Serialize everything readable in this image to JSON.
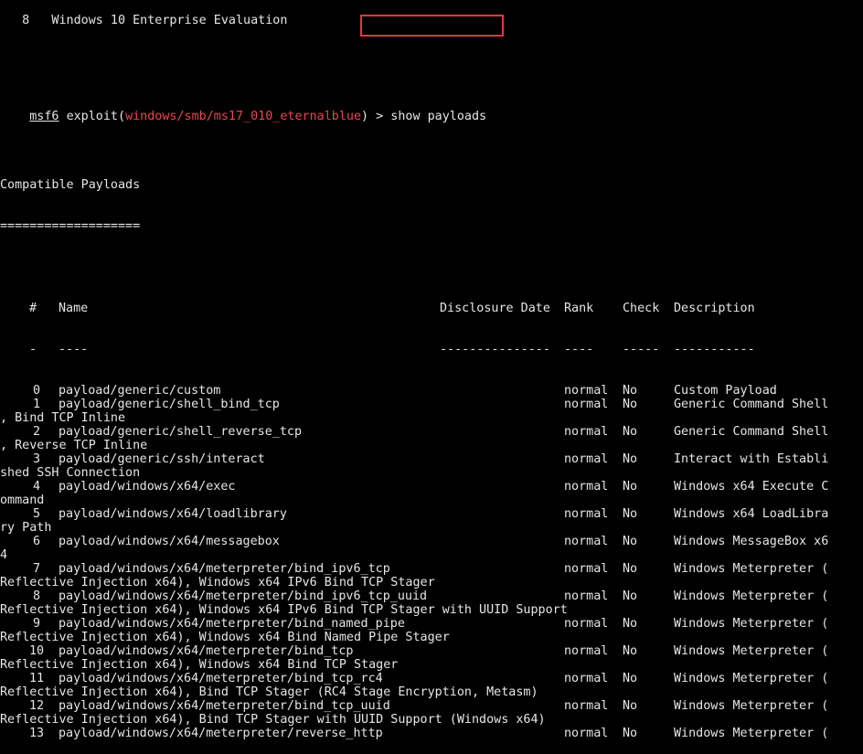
{
  "prior_line": "   8   Windows 10 Enterprise Evaluation",
  "prompt": {
    "app": "msf6",
    "word": "exploit",
    "open_paren": "(",
    "module": "windows/smb/ms17_010_eternalblue",
    "close_paren": ")",
    "symbol": ">",
    "command": "show payloads"
  },
  "section_title": "Compatible Payloads",
  "section_rule": "===================",
  "headers": {
    "num": "#",
    "name": "Name",
    "date": "Disclosure Date",
    "rank": "Rank",
    "check": "Check",
    "desc": "Description"
  },
  "dashes": {
    "num": "-",
    "name": "----",
    "date": "---------------",
    "rank": "----",
    "check": "-----",
    "desc": "-----------"
  },
  "rows": [
    {
      "num": "0",
      "name": "payload/generic/custom",
      "rank": "normal",
      "check": "No",
      "desc": "Custom Payload",
      "cont": ""
    },
    {
      "num": "1",
      "name": "payload/generic/shell_bind_tcp",
      "rank": "normal",
      "check": "No",
      "desc": "Generic Command Shell",
      "cont": ", Bind TCP Inline"
    },
    {
      "num": "2",
      "name": "payload/generic/shell_reverse_tcp",
      "rank": "normal",
      "check": "No",
      "desc": "Generic Command Shell",
      "cont": ", Reverse TCP Inline"
    },
    {
      "num": "3",
      "name": "payload/generic/ssh/interact",
      "rank": "normal",
      "check": "No",
      "desc": "Interact with Establi",
      "cont": "shed SSH Connection"
    },
    {
      "num": "4",
      "name": "payload/windows/x64/exec",
      "rank": "normal",
      "check": "No",
      "desc": "Windows x64 Execute C",
      "cont": "ommand"
    },
    {
      "num": "5",
      "name": "payload/windows/x64/loadlibrary",
      "rank": "normal",
      "check": "No",
      "desc": "Windows x64 LoadLibra",
      "cont": "ry Path"
    },
    {
      "num": "6",
      "name": "payload/windows/x64/messagebox",
      "rank": "normal",
      "check": "No",
      "desc": "Windows MessageBox x6",
      "cont": "4"
    },
    {
      "num": "7",
      "name": "payload/windows/x64/meterpreter/bind_ipv6_tcp",
      "rank": "normal",
      "check": "No",
      "desc": "Windows Meterpreter (",
      "cont": "Reflective Injection x64), Windows x64 IPv6 Bind TCP Stager"
    },
    {
      "num": "8",
      "name": "payload/windows/x64/meterpreter/bind_ipv6_tcp_uuid",
      "rank": "normal",
      "check": "No",
      "desc": "Windows Meterpreter (",
      "cont": "Reflective Injection x64), Windows x64 IPv6 Bind TCP Stager with UUID Support"
    },
    {
      "num": "9",
      "name": "payload/windows/x64/meterpreter/bind_named_pipe",
      "rank": "normal",
      "check": "No",
      "desc": "Windows Meterpreter (",
      "cont": "Reflective Injection x64), Windows x64 Bind Named Pipe Stager"
    },
    {
      "num": "10",
      "name": "payload/windows/x64/meterpreter/bind_tcp",
      "rank": "normal",
      "check": "No",
      "desc": "Windows Meterpreter (",
      "cont": "Reflective Injection x64), Windows x64 Bind TCP Stager"
    },
    {
      "num": "11",
      "name": "payload/windows/x64/meterpreter/bind_tcp_rc4",
      "rank": "normal",
      "check": "No",
      "desc": "Windows Meterpreter (",
      "cont": "Reflective Injection x64), Bind TCP Stager (RC4 Stage Encryption, Metasm)"
    },
    {
      "num": "12",
      "name": "payload/windows/x64/meterpreter/bind_tcp_uuid",
      "rank": "normal",
      "check": "No",
      "desc": "Windows Meterpreter (",
      "cont": "Reflective Injection x64), Bind TCP Stager with UUID Support (Windows x64)"
    },
    {
      "num": "13",
      "name": "payload/windows/x64/meterpreter/reverse_http",
      "rank": "normal",
      "check": "No",
      "desc": "Windows Meterpreter (",
      "cont": ""
    }
  ],
  "colors": {
    "background": "#000000",
    "text": "#e6e6e6",
    "module": "#e8484d",
    "highlight_box": "#e0393e"
  }
}
